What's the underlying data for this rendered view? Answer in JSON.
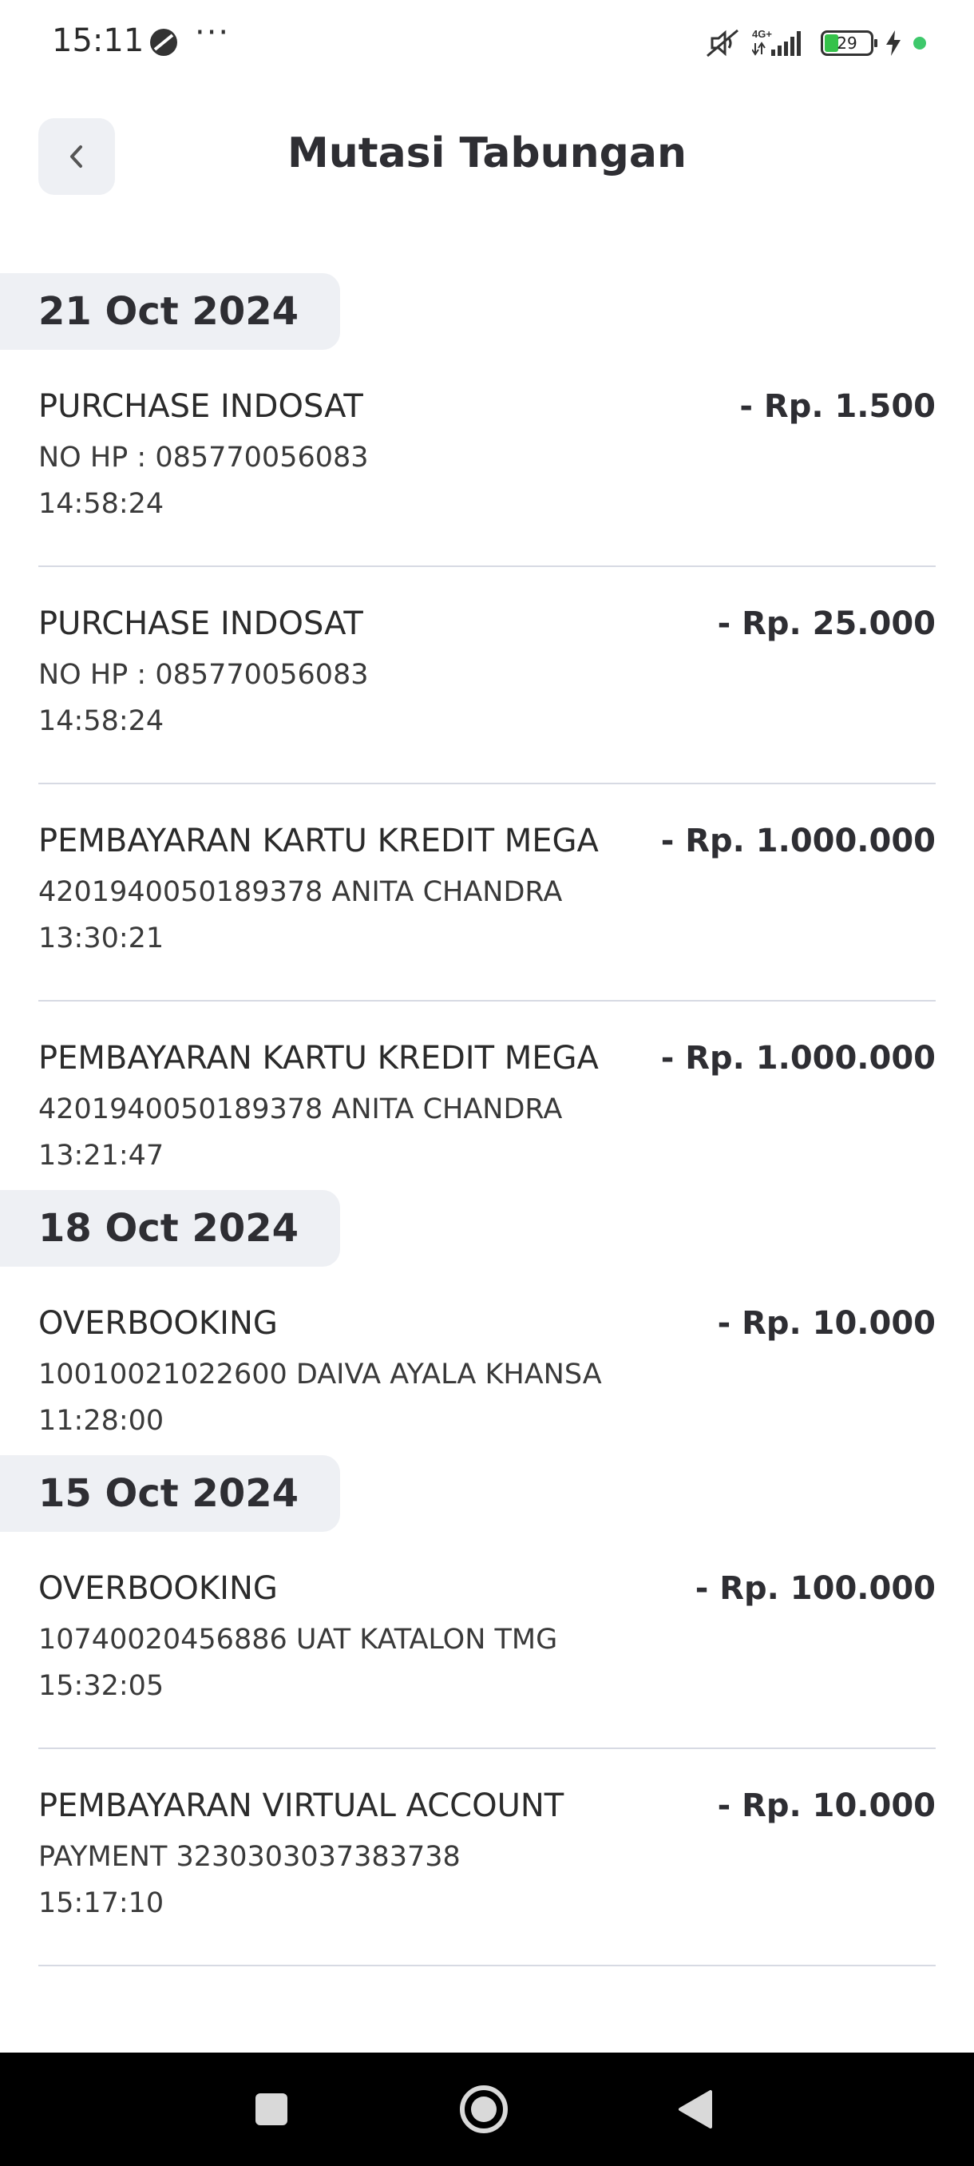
{
  "status_bar": {
    "time": "15:11",
    "network": "4G+",
    "battery": 29,
    "icons": [
      "dnd-icon",
      "more-dots-icon",
      "mute-icon",
      "signal-icon",
      "battery-icon",
      "charging-icon",
      "active-dot-icon"
    ]
  },
  "header": {
    "title": "Mutasi Tabungan",
    "back_icon": "chevron-left-icon"
  },
  "groups": [
    {
      "date": "21 Oct 2024",
      "transactions": [
        {
          "title": "PURCHASE INDOSAT",
          "amount": "- Rp. 1.500",
          "desc": "NO HP : 085770056083",
          "time": "14:58:24"
        },
        {
          "title": "PURCHASE INDOSAT",
          "amount": "- Rp. 25.000",
          "desc": "NO HP : 085770056083",
          "time": "14:58:24"
        },
        {
          "title": "PEMBAYARAN KARTU KREDIT MEGA",
          "amount": "- Rp. 1.000.000",
          "desc": "4201940050189378 ANITA CHANDRA",
          "time": "13:30:21"
        },
        {
          "title": "PEMBAYARAN KARTU KREDIT MEGA",
          "amount": "- Rp. 1.000.000",
          "desc": "4201940050189378 ANITA CHANDRA",
          "time": "13:21:47"
        }
      ]
    },
    {
      "date": "18 Oct 2024",
      "transactions": [
        {
          "title": "OVERBOOKING",
          "amount": "- Rp. 10.000",
          "desc": "10010021022600 DAIVA AYALA KHANSA",
          "time": "11:28:00"
        }
      ]
    },
    {
      "date": "15 Oct 2024",
      "transactions": [
        {
          "title": "OVERBOOKING",
          "amount": "- Rp. 100.000",
          "desc": "10740020456886 UAT KATALON TMG",
          "time": "15:32:05"
        },
        {
          "title": "PEMBAYARAN VIRTUAL ACCOUNT",
          "amount": "- Rp. 10.000",
          "desc": "PAYMENT 3230303037383738",
          "time": "15:17:10"
        }
      ]
    }
  ],
  "nav_bar": {
    "icons": [
      "recents-square-icon",
      "home-circle-icon",
      "back-triangle-icon"
    ]
  }
}
